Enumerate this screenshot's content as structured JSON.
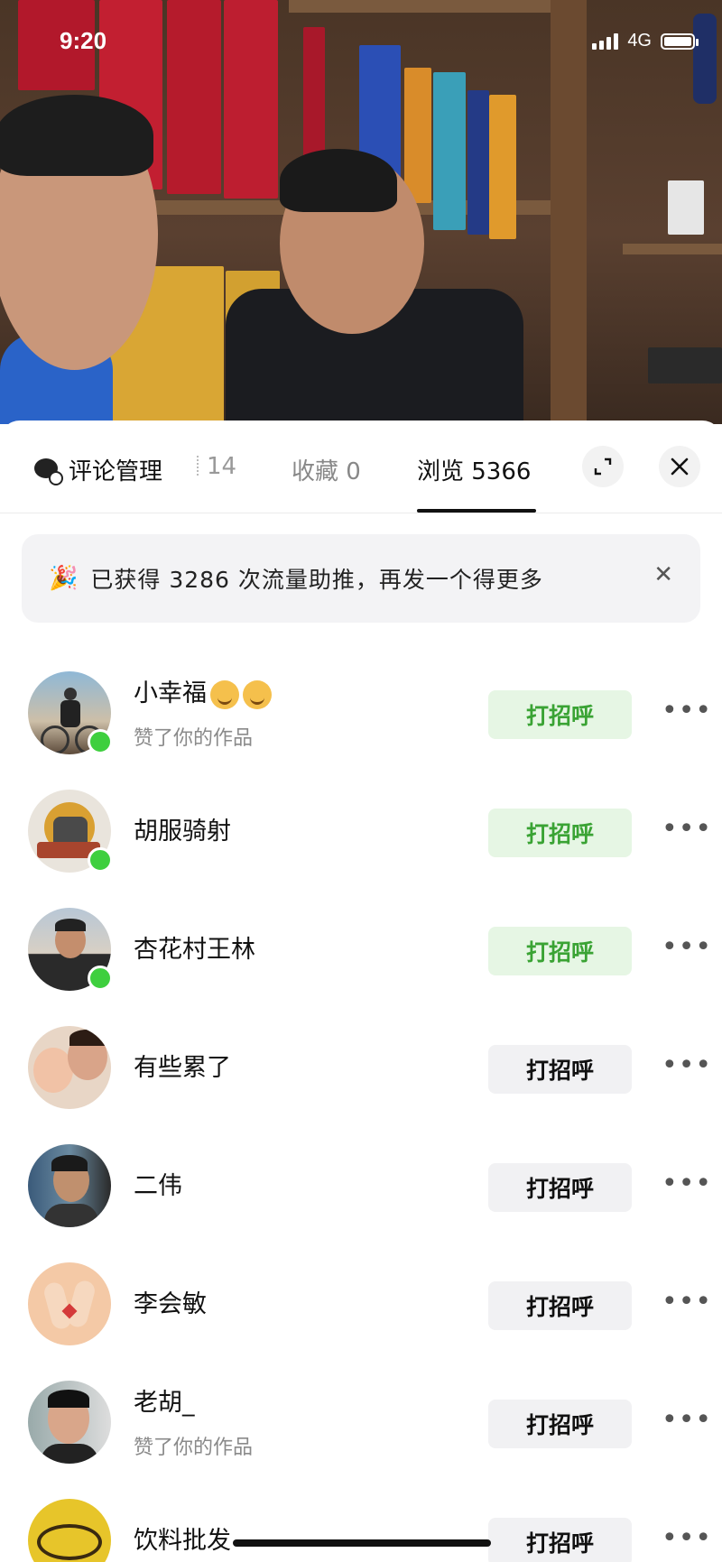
{
  "status_bar": {
    "time": "9:20",
    "network": "4G"
  },
  "tabs": {
    "comment_manage": "评论管理",
    "partial_count": "14",
    "favorites": "收藏 0",
    "views": "浏览 5366",
    "active": "views"
  },
  "banner": {
    "icon": "party-popper-icon",
    "text": "已获得 3286 次流量助推，再发一个得更多"
  },
  "list": {
    "hello_label": "打招呼",
    "items": [
      {
        "name": "小幸福",
        "emoji_count": 2,
        "subtitle": "赞了你的作品",
        "online": true,
        "button_style": "green"
      },
      {
        "name": "胡服骑射",
        "subtitle": "",
        "online": true,
        "button_style": "green"
      },
      {
        "name": "杏花村王林",
        "subtitle": "",
        "online": true,
        "button_style": "green"
      },
      {
        "name": "有些累了",
        "subtitle": "",
        "online": false,
        "button_style": "gray"
      },
      {
        "name": "二伟",
        "subtitle": "",
        "online": false,
        "button_style": "gray"
      },
      {
        "name": "李会敏",
        "subtitle": "",
        "online": false,
        "button_style": "gray"
      },
      {
        "name": "老胡_",
        "subtitle": "赞了你的作品",
        "online": false,
        "button_style": "gray"
      },
      {
        "name": "饮料批发",
        "subtitle": "",
        "online": false,
        "button_style": "gray"
      }
    ]
  },
  "colors": {
    "green_button_bg": "#e6f6e4",
    "green_button_text": "#3aa334",
    "gray_button_bg": "#f1f1f3",
    "online_dot": "#3ecf3e"
  }
}
